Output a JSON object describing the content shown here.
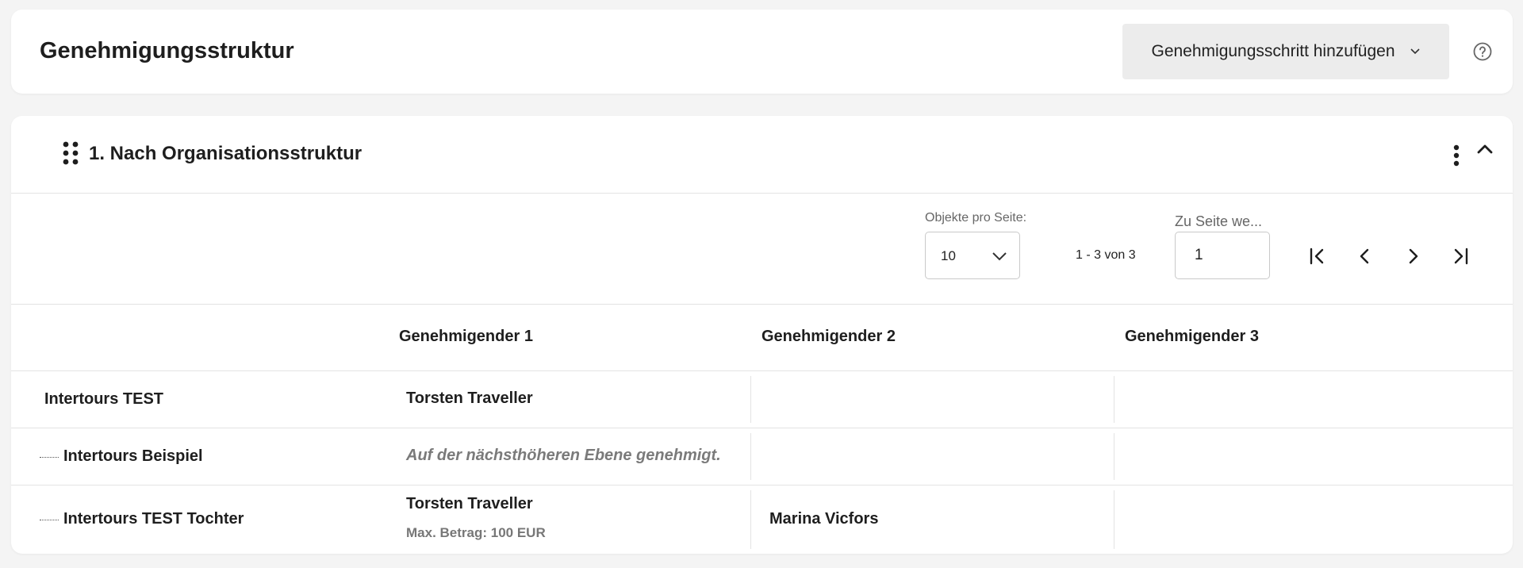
{
  "header": {
    "title": "Genehmigungsstruktur",
    "add_step_label": "Genehmigungsschritt hinzufügen"
  },
  "section": {
    "title": "1. Nach Organisationsstruktur"
  },
  "pagination": {
    "per_page_label": "Objekte pro Seite:",
    "per_page_value": "10",
    "range_text": "1 - 3 von 3",
    "goto_label": "Zu Seite we...",
    "goto_value": "1"
  },
  "table": {
    "columns": [
      "Genehmigender 1",
      "Genehmigender 2",
      "Genehmigender 3"
    ],
    "rows": [
      {
        "unit": "Intertours TEST",
        "approver1": "Torsten Traveller",
        "approver1_note": "",
        "approver2": "",
        "approver3": ""
      },
      {
        "unit": "Intertours Beispiel",
        "approver1": "Auf der nächsthöheren Ebene genehmigt.",
        "approver2": "",
        "approver3": ""
      },
      {
        "unit": "Intertours TEST Tochter",
        "approver1": "Torsten Traveller",
        "approver1_note": "Max. Betrag: 100 EUR",
        "approver2": "Marina Vicfors",
        "approver3": ""
      }
    ]
  },
  "icons": {
    "help": "help-circle-icon",
    "drag": "drag-handle-icon",
    "menu": "kebab-menu-icon",
    "collapse": "chevron-up-icon",
    "first": "first-page-icon",
    "prev": "prev-page-icon",
    "next": "next-page-icon",
    "last": "last-page-icon"
  }
}
